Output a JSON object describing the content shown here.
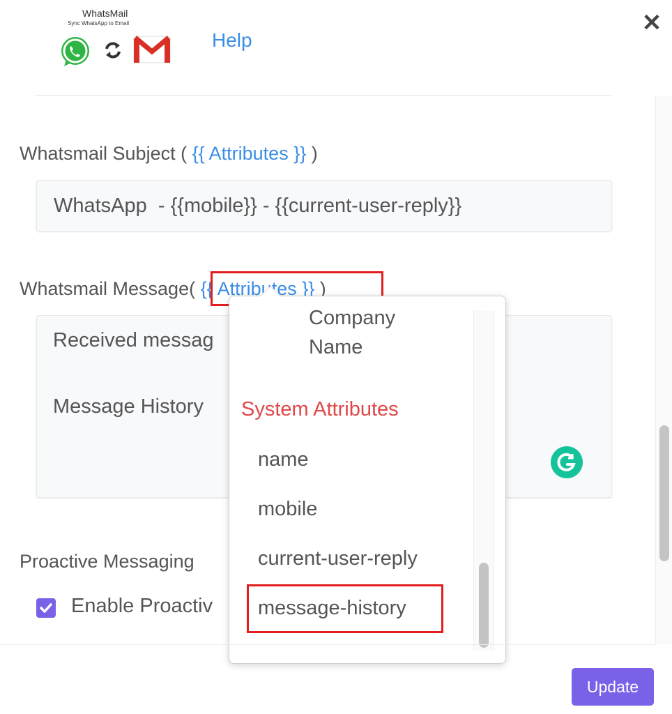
{
  "header": {
    "logo_title": "WhatsMail",
    "logo_tagline": "Sync WhatsApp to Email",
    "help_label": "Help",
    "close_glyph": "✕"
  },
  "subject": {
    "label": "Whatsmail Subject (",
    "attributes_link": "{{ Attributes }}",
    "label_close": ")",
    "value": "WhatsApp  - {{mobile}} - {{current-user-reply}}"
  },
  "message": {
    "label": "Whatsmail Message",
    "label_open": "(",
    "attributes_link": "{{ Attributes }}",
    "label_close": ")",
    "line1": "Received messag",
    "line2": "Message History"
  },
  "proactive": {
    "label": "Proactive Messaging",
    "checkbox_label": "Enable Proactiv",
    "checked": true
  },
  "attributes_dropdown": {
    "company_name": "Company Name",
    "section_title": "System Attributes",
    "items": [
      "name",
      "mobile",
      "current-user-reply",
      "message-history"
    ]
  },
  "footer": {
    "update_label": "Update"
  },
  "colors": {
    "accent": "#7b61e8",
    "link": "#3a8ee6",
    "section_title": "#e0484a",
    "highlight": "#e11d1d",
    "grammarly": "#15c39a"
  },
  "icons": [
    "whatsapp-icon",
    "sync-icon",
    "gmail-icon",
    "close-icon",
    "grammarly-icon",
    "check-icon"
  ]
}
